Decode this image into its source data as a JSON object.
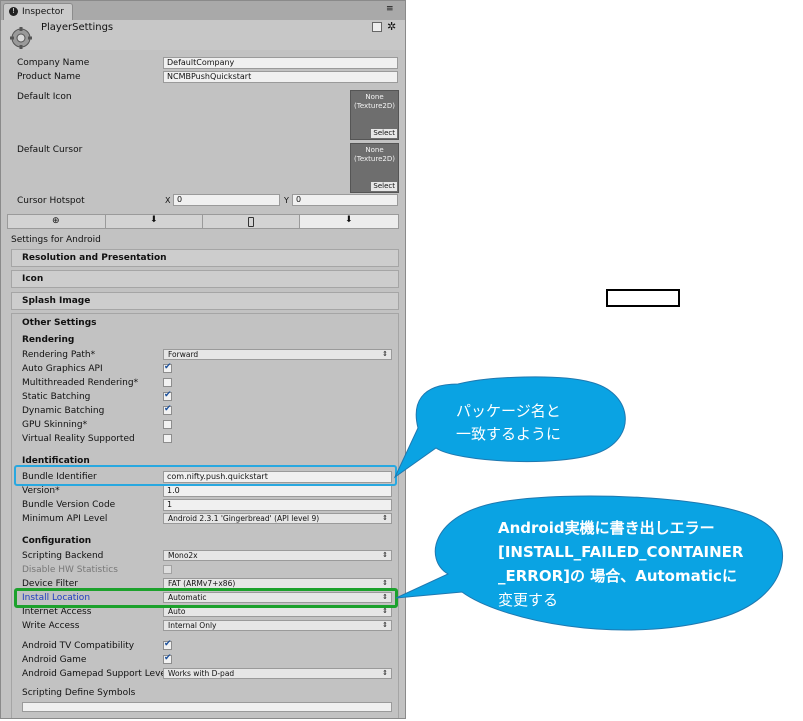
{
  "window": {
    "tab_title": "Inspector",
    "header_title": "PlayerSettings"
  },
  "player": {
    "company_label": "Company Name",
    "company_value": "DefaultCompany",
    "product_label": "Product Name",
    "product_value": "NCMBPushQuickstart",
    "default_icon_label": "Default Icon",
    "default_cursor_label": "Default Cursor",
    "texture_text_1": "None",
    "texture_text_2": "(Texture2D)",
    "select_label": "Select",
    "hotspot_label": "Cursor Hotspot",
    "hotspot_x_label": "X",
    "hotspot_x": "0",
    "hotspot_y_label": "Y",
    "hotspot_y": "0"
  },
  "platform": {
    "settings_for": "Settings for Android"
  },
  "sections": {
    "resolution": "Resolution and Presentation",
    "icon": "Icon",
    "splash": "Splash Image",
    "other": "Other Settings"
  },
  "rendering": {
    "title": "Rendering",
    "path_label": "Rendering Path*",
    "path_value": "Forward",
    "auto_graphics": "Auto Graphics API",
    "multithreaded": "Multithreaded Rendering*",
    "static_batching": "Static Batching",
    "dynamic_batching": "Dynamic Batching",
    "gpu_skinning": "GPU Skinning*",
    "vr_supported": "Virtual Reality Supported"
  },
  "identification": {
    "title": "Identification",
    "bundle_id_label": "Bundle Identifier",
    "bundle_id_value": "com.nifty.push.quickstart",
    "version_label": "Version*",
    "version_value": "1.0",
    "bundle_code_label": "Bundle Version Code",
    "bundle_code_value": "1",
    "min_api_label": "Minimum API Level",
    "min_api_value": "Android 2.3.1 'Gingerbread' (API level 9)"
  },
  "configuration": {
    "title": "Configuration",
    "backend_label": "Scripting Backend",
    "backend_value": "Mono2x",
    "disable_hw_label": "Disable HW Statistics",
    "device_filter_label": "Device Filter",
    "device_filter_value": "FAT (ARMv7+x86)",
    "install_location_label": "Install Location",
    "install_location_value": "Automatic",
    "internet_label": "Internet Access",
    "internet_value": "Auto",
    "write_label": "Write Access",
    "write_value": "Internal Only",
    "tv_label": "Android TV Compatibility",
    "game_label": "Android Game",
    "gamepad_label": "Android Gamepad Support Leve",
    "gamepad_value": "Works with D-pad",
    "define_symbols_label": "Scripting Define Symbols"
  },
  "callouts": {
    "blue_line1": "パッケージ名と",
    "blue_line2": "一致するように",
    "green_line1": "Android実機に書き出しエラー",
    "green_line2": "[INSTALL_FAILED_CONTAINER",
    "green_line3": "_ERROR]の 場合、Automaticに",
    "green_line4": "変更する"
  },
  "colors": {
    "callout_fill": "#0aa3e3",
    "blue_highlight": "#28a8e0",
    "green_highlight": "#1ca12c"
  },
  "icons": [
    "info-icon",
    "gear-icon",
    "book-icon",
    "settings-icon",
    "globe-icon",
    "download-icon",
    "phone-icon",
    "android-icon",
    "chevron-icon"
  ]
}
